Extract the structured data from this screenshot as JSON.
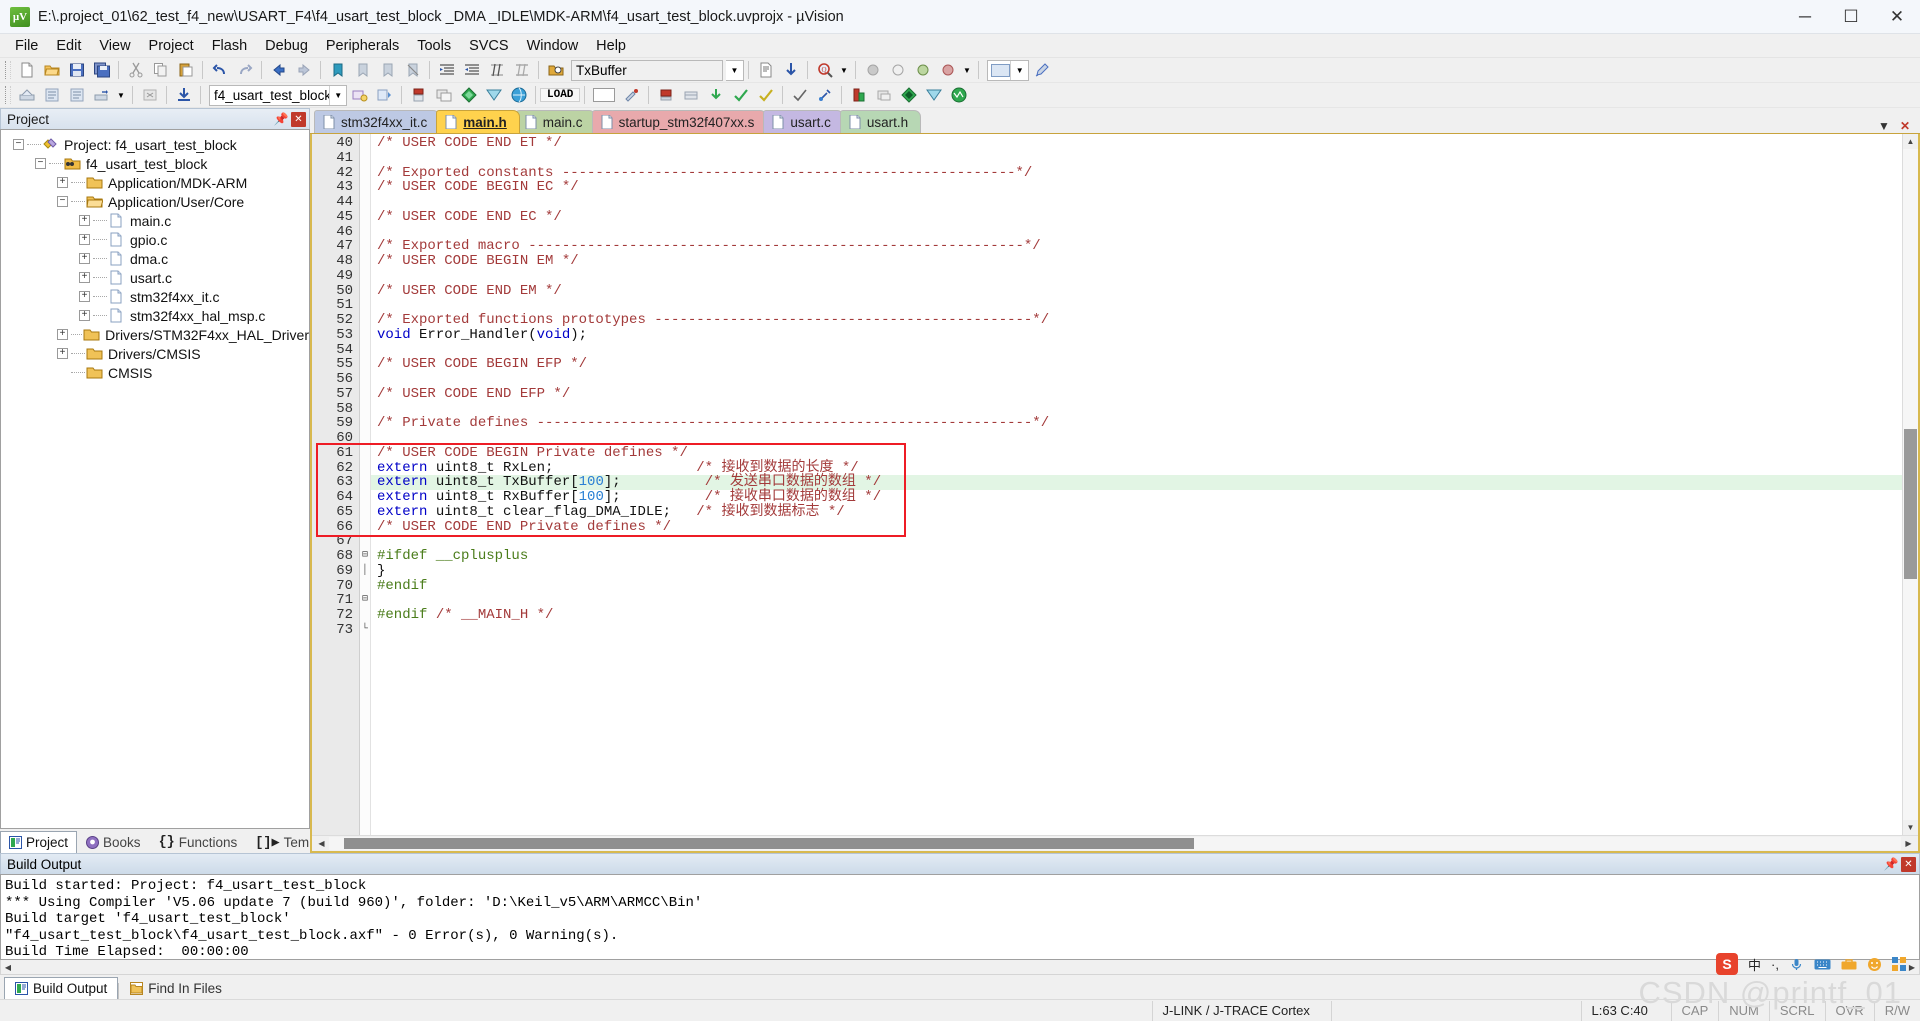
{
  "window": {
    "title": "E:\\.project_01\\62_test_f4_new\\USART_F4\\f4_usart_test_block _DMA _IDLE\\MDK-ARM\\f4_usart_test_block.uvprojx - µVision",
    "app_icon": "uvision-icon",
    "minimize": "─",
    "maximize": "☐",
    "close": "✕"
  },
  "menubar": {
    "items": [
      {
        "label": "File"
      },
      {
        "label": "Edit"
      },
      {
        "label": "View"
      },
      {
        "label": "Project"
      },
      {
        "label": "Flash"
      },
      {
        "label": "Debug"
      },
      {
        "label": "Peripherals"
      },
      {
        "label": "Tools"
      },
      {
        "label": "SVCS"
      },
      {
        "label": "Window"
      },
      {
        "label": "Help"
      }
    ]
  },
  "toolbar1": {
    "find_combo_value": "TxBuffer",
    "icons": [
      "new-file-icon",
      "open-file-icon",
      "save-icon",
      "save-all-icon",
      "cut-icon",
      "copy-icon",
      "paste-icon",
      "undo-icon",
      "redo-icon",
      "back-icon",
      "forward-icon",
      "bookmark-toggle-icon",
      "bookmark-prev-icon",
      "bookmark-next-icon",
      "bookmark-clear-icon",
      "indent-icon",
      "outdent-icon",
      "comment-icon",
      "uncomment-icon",
      "find-in-files-icon",
      "search-dropdown-icon",
      "insert-file-icon",
      "find-next-icon",
      "find-icon",
      "find-caret-icon",
      "debug-stop-icon"
    ]
  },
  "toolbar2": {
    "target_value": "f4_usart_test_block",
    "load_label": "LOAD",
    "icons": [
      "build-icon",
      "rebuild-icon",
      "batch-build-icon",
      "translate-icon",
      "stop-build-icon",
      "download-icon",
      "target-options-icon",
      "manage-project-items-icon",
      "configuration-wizard-icon",
      "debug-session-icon",
      "breakpoint-icon",
      "window-icon",
      "packs-icon",
      "pack-installer-icon",
      "manage-runtime-icon"
    ]
  },
  "project_pane": {
    "header": "Project",
    "pin_icon": "pin-icon",
    "close_icon": "close-icon",
    "tree": [
      {
        "label": "Project: f4_usart_test_block",
        "depth": 0,
        "expander": "-",
        "icon": "project-icon"
      },
      {
        "label": "f4_usart_test_block",
        "depth": 1,
        "expander": "-",
        "icon": "target-icon"
      },
      {
        "label": "Application/MDK-ARM",
        "depth": 2,
        "expander": "+",
        "icon": "folder-closed-icon"
      },
      {
        "label": "Application/User/Core",
        "depth": 2,
        "expander": "-",
        "icon": "folder-open-icon"
      },
      {
        "label": "main.c",
        "depth": 3,
        "expander": "+",
        "icon": "c-file-icon"
      },
      {
        "label": "gpio.c",
        "depth": 3,
        "expander": "+",
        "icon": "c-file-icon"
      },
      {
        "label": "dma.c",
        "depth": 3,
        "expander": "+",
        "icon": "c-file-icon"
      },
      {
        "label": "usart.c",
        "depth": 3,
        "expander": "+",
        "icon": "c-file-icon"
      },
      {
        "label": "stm32f4xx_it.c",
        "depth": 3,
        "expander": "+",
        "icon": "c-file-icon"
      },
      {
        "label": "stm32f4xx_hal_msp.c",
        "depth": 3,
        "expander": "+",
        "icon": "c-file-icon"
      },
      {
        "label": "Drivers/STM32F4xx_HAL_Driver",
        "depth": 2,
        "expander": "+",
        "icon": "folder-closed-icon"
      },
      {
        "label": "Drivers/CMSIS",
        "depth": 2,
        "expander": "+",
        "icon": "folder-closed-icon"
      },
      {
        "label": "CMSIS",
        "depth": 2,
        "expander": "",
        "icon": "folder-closed-icon"
      }
    ],
    "bottom_tabs": [
      {
        "label": "Project",
        "icon": "project-tab-icon",
        "active": true
      },
      {
        "label": "Books",
        "icon": "books-tab-icon",
        "active": false
      },
      {
        "label": "Functions",
        "icon": "functions-tab-icon",
        "active": false
      },
      {
        "label": "Templates",
        "icon": "templates-tab-icon",
        "active": false
      }
    ]
  },
  "editor": {
    "tabs": [
      {
        "label": "stm32f4xx_it.c",
        "color": "blue",
        "active": false
      },
      {
        "label": "main.h",
        "color": "yellow",
        "active": true
      },
      {
        "label": "main.c",
        "color": "green",
        "active": false
      },
      {
        "label": "startup_stm32f407xx.s",
        "color": "red",
        "active": false
      },
      {
        "label": "usart.c",
        "color": "purple",
        "active": false
      },
      {
        "label": "usart.h",
        "color": "green2",
        "active": false
      }
    ],
    "tab_controls": {
      "down": "▼",
      "close": "✕"
    },
    "first_line_number": 40,
    "lines": [
      {
        "n": 40,
        "fold": "",
        "hl": false,
        "tokens": [
          {
            "t": "/* USER CODE END ET */",
            "c": "cm"
          }
        ]
      },
      {
        "n": 41,
        "fold": "",
        "hl": false,
        "tokens": []
      },
      {
        "n": 42,
        "fold": "",
        "hl": false,
        "tokens": [
          {
            "t": "/* Exported constants ------------------------------------------------------*/",
            "c": "cm"
          }
        ]
      },
      {
        "n": 43,
        "fold": "",
        "hl": false,
        "tokens": [
          {
            "t": "/* USER CODE BEGIN EC */",
            "c": "cm"
          }
        ]
      },
      {
        "n": 44,
        "fold": "",
        "hl": false,
        "tokens": []
      },
      {
        "n": 45,
        "fold": "",
        "hl": false,
        "tokens": [
          {
            "t": "/* USER CODE END EC */",
            "c": "cm"
          }
        ]
      },
      {
        "n": 46,
        "fold": "",
        "hl": false,
        "tokens": []
      },
      {
        "n": 47,
        "fold": "",
        "hl": false,
        "tokens": [
          {
            "t": "/* Exported macro -----------------------------------------------------------*/",
            "c": "cm"
          }
        ]
      },
      {
        "n": 48,
        "fold": "",
        "hl": false,
        "tokens": [
          {
            "t": "/* USER CODE BEGIN EM */",
            "c": "cm"
          }
        ]
      },
      {
        "n": 49,
        "fold": "",
        "hl": false,
        "tokens": []
      },
      {
        "n": 50,
        "fold": "",
        "hl": false,
        "tokens": [
          {
            "t": "/* USER CODE END EM */",
            "c": "cm"
          }
        ]
      },
      {
        "n": 51,
        "fold": "",
        "hl": false,
        "tokens": []
      },
      {
        "n": 52,
        "fold": "",
        "hl": false,
        "tokens": [
          {
            "t": "/* Exported functions prototypes ---------------------------------------------*/",
            "c": "cm"
          }
        ]
      },
      {
        "n": 53,
        "fold": "",
        "hl": false,
        "tokens": [
          {
            "t": "void",
            "c": "kw"
          },
          {
            "t": " Error_Handler(",
            "c": "pl"
          },
          {
            "t": "void",
            "c": "kw"
          },
          {
            "t": ");",
            "c": "pl"
          }
        ]
      },
      {
        "n": 54,
        "fold": "",
        "hl": false,
        "tokens": []
      },
      {
        "n": 55,
        "fold": "",
        "hl": false,
        "tokens": [
          {
            "t": "/* USER CODE BEGIN EFP */",
            "c": "cm"
          }
        ]
      },
      {
        "n": 56,
        "fold": "",
        "hl": false,
        "tokens": []
      },
      {
        "n": 57,
        "fold": "",
        "hl": false,
        "tokens": [
          {
            "t": "/* USER CODE END EFP */",
            "c": "cm"
          }
        ]
      },
      {
        "n": 58,
        "fold": "",
        "hl": false,
        "tokens": []
      },
      {
        "n": 59,
        "fold": "",
        "hl": false,
        "tokens": [
          {
            "t": "/* Private defines -----------------------------------------------------------*/",
            "c": "cm"
          }
        ]
      },
      {
        "n": 60,
        "fold": "",
        "hl": false,
        "tokens": []
      },
      {
        "n": 61,
        "fold": "",
        "hl": false,
        "tokens": [
          {
            "t": "/* USER CODE BEGIN Private defines */",
            "c": "cm"
          }
        ]
      },
      {
        "n": 62,
        "fold": "",
        "hl": false,
        "tokens": [
          {
            "t": "extern",
            "c": "kw"
          },
          {
            "t": " uint8_t RxLen;",
            "c": "pl"
          },
          {
            "t": "                 /* 接收到数据的长度 */",
            "c": "cm"
          }
        ]
      },
      {
        "n": 63,
        "fold": "",
        "hl": true,
        "tokens": [
          {
            "t": "extern",
            "c": "kw"
          },
          {
            "t": " uint8_t TxBuffer[",
            "c": "pl"
          },
          {
            "t": "100",
            "c": "num"
          },
          {
            "t": "];",
            "c": "pl"
          },
          {
            "t": "          /* 发送串口数据的数组 */",
            "c": "cm"
          }
        ]
      },
      {
        "n": 64,
        "fold": "",
        "hl": false,
        "tokens": [
          {
            "t": "extern",
            "c": "kw"
          },
          {
            "t": " uint8_t RxBuffer[",
            "c": "pl"
          },
          {
            "t": "100",
            "c": "num"
          },
          {
            "t": "];",
            "c": "pl"
          },
          {
            "t": "          /* 接收串口数据的数组 */",
            "c": "cm"
          }
        ]
      },
      {
        "n": 65,
        "fold": "",
        "hl": false,
        "tokens": [
          {
            "t": "extern",
            "c": "kw"
          },
          {
            "t": " uint8_t clear_flag_DMA_IDLE;",
            "c": "pl"
          },
          {
            "t": "   /* 接收到数据标志 */",
            "c": "cm"
          }
        ]
      },
      {
        "n": 66,
        "fold": "",
        "hl": false,
        "tokens": [
          {
            "t": "/* USER CODE END Private defines */",
            "c": "cm"
          }
        ]
      },
      {
        "n": 67,
        "fold": "",
        "hl": false,
        "tokens": []
      },
      {
        "n": 68,
        "fold": "-",
        "hl": false,
        "tokens": [
          {
            "t": "#ifdef __cplusplus",
            "c": "pp"
          }
        ]
      },
      {
        "n": 69,
        "fold": "|",
        "hl": false,
        "tokens": [
          {
            "t": "}",
            "c": "pl"
          }
        ]
      },
      {
        "n": 70,
        "fold": "",
        "hl": false,
        "tokens": [
          {
            "t": "#endif",
            "c": "pp"
          }
        ]
      },
      {
        "n": 71,
        "fold": "-",
        "hl": false,
        "tokens": []
      },
      {
        "n": 72,
        "fold": "",
        "hl": false,
        "tokens": [
          {
            "t": "#endif",
            "c": "pp"
          },
          {
            "t": " /* __MAIN_H */",
            "c": "cm"
          }
        ]
      },
      {
        "n": 73,
        "fold": "L",
        "hl": false,
        "tokens": []
      }
    ],
    "annotation": {
      "type": "red-rectangle",
      "from_line": 61,
      "to_line": 66,
      "color": "#ee1c25"
    }
  },
  "build_output": {
    "header": "Build Output",
    "pin_icon": "pin-icon",
    "close_icon": "close-icon",
    "lines": [
      "Build started: Project: f4_usart_test_block",
      "*** Using Compiler 'V5.06 update 7 (build 960)', folder: 'D:\\Keil_v5\\ARM\\ARMCC\\Bin'",
      "Build target 'f4_usart_test_block'",
      "\"f4_usart_test_block\\f4_usart_test_block.axf\" - 0 Error(s), 0 Warning(s).",
      "Build Time Elapsed:  00:00:00"
    ],
    "bottom_tabs": [
      {
        "label": "Build Output",
        "icon": "build-output-tab-icon",
        "active": true
      },
      {
        "label": "Find In Files",
        "icon": "find-in-files-tab-icon",
        "active": false
      }
    ]
  },
  "statusbar": {
    "debugger": "J-LINK / J-TRACE Cortex",
    "cursor": "L:63 C:40",
    "indicators": [
      "CAP",
      "NUM",
      "SCRL",
      "OVR",
      "R/W"
    ]
  },
  "ime_tray": {
    "logo": "S",
    "items": [
      "中",
      "·,",
      "mic-icon",
      "keyboard-icon",
      "toolbox-icon",
      "smiley-icon",
      "grid-icon"
    ]
  },
  "watermark": "CSDN @printf_01",
  "colors": {
    "accent": "#d8b94f",
    "annotation": "#ee1c25",
    "comment": "#a33a3a",
    "keyword": "#0000c8",
    "number": "#2a7fd4",
    "preprocessor": "#4a7c1a",
    "highlight_line": "#e2f5e4",
    "tab_active": "#ffd24d"
  }
}
